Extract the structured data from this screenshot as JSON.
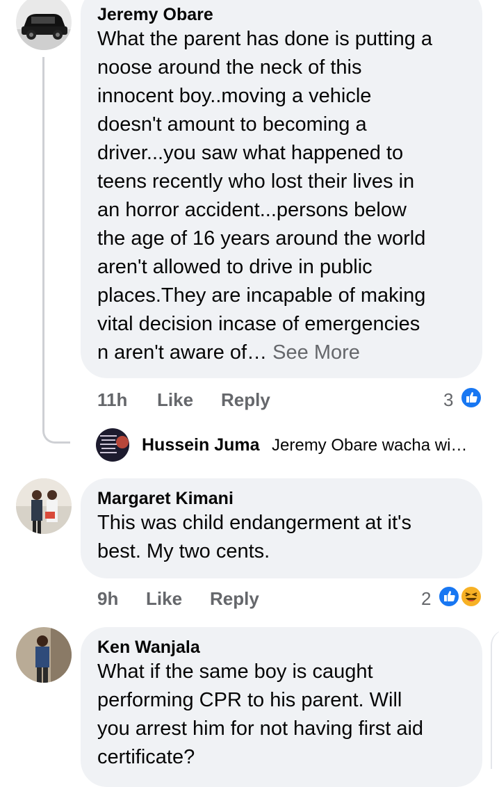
{
  "comments": [
    {
      "author": "Jeremy Obare",
      "text_lines": [
        "What the parent has done is putting a",
        "noose around the neck of this",
        "innocent boy..moving a vehicle",
        "doesn't amount to becoming a",
        "driver...you saw what happened to",
        "teens recently who lost their lives in",
        "an horror accident...persons  below",
        "the age of 16 years around the world",
        "aren't allowed to drive in public",
        "places.They are  incapable of making",
        "vital decision incase of emergencies"
      ],
      "last_line": "n aren't aware of… ",
      "see_more": "See More",
      "time": "11h",
      "like": "Like",
      "reply": "Reply",
      "reaction_count": "3",
      "reactions": [
        "like-icon"
      ]
    },
    {
      "author": "Margaret Kimani",
      "text_lines": [
        "This was child endangerment at it's",
        "best.  My two cents."
      ],
      "time": "9h",
      "like": "Like",
      "reply": "Reply",
      "reaction_count": "2",
      "reactions": [
        "like-icon",
        "haha-icon"
      ]
    },
    {
      "author": "Ken Wanjala",
      "text_lines": [
        "What if the same boy is caught",
        "performing CPR to his parent. Will",
        "you arrest him for not having first aid",
        "certificate?"
      ]
    }
  ],
  "reply_preview": {
    "author": "Hussein Juma",
    "text": "Jeremy Obare wacha wi…"
  },
  "colors": {
    "bubble": "#f0f2f5",
    "secondary_text": "#65676b",
    "like_blue": "#1877f2",
    "haha_yellow": "#f7b125"
  }
}
